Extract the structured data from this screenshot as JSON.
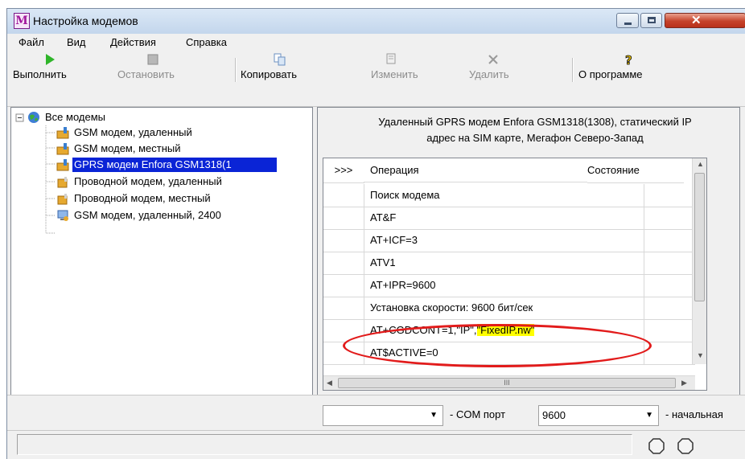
{
  "window": {
    "title": "Настройка модемов",
    "app_icon_letter": "M"
  },
  "menu": [
    "Файл",
    "Вид",
    "Действия",
    "Справка"
  ],
  "toolbar": {
    "run": "Выполнить",
    "stop": "Остановить",
    "copy": "Копировать",
    "edit": "Изменить",
    "delete": "Удалить",
    "about": "О программе"
  },
  "tree": {
    "root": "Все модемы",
    "items": [
      "GSM модем, удаленный",
      "GSM модем, местный",
      "GPRS модем Enfora GSM1318(1",
      "Проводной модем, удаленный",
      "Проводной модем, местный",
      "GSM модем, удаленный, 2400"
    ],
    "selected_index": 2
  },
  "detail": {
    "description_line1": "Удаленный GPRS модем Enfora GSM1318(1308), статический IP",
    "description_line2": "адрес на SIM карте, Мегафон Северо-Запад"
  },
  "grid": {
    "headers": {
      "arrow": ">>>",
      "operation": "Операция",
      "state": "Состояние"
    },
    "rows": [
      {
        "op": "Поиск модема"
      },
      {
        "op": "AT&F"
      },
      {
        "op": "AT+ICF=3"
      },
      {
        "op": "ATV1"
      },
      {
        "op": "AT+IPR=9600"
      },
      {
        "op": "Установка скорости: 9600 бит/сек"
      },
      {
        "op_prefix": "AT+CGDCONT=1,\"IP\",",
        "op_highlight": "\"FixedIP.nw\""
      },
      {
        "op": "AT$ACTIVE=0"
      }
    ],
    "hscroll_grip": "III"
  },
  "bottom": {
    "port_combo_value": "",
    "com_label": "- COM порт",
    "speed_value": "9600",
    "speed_label": "- начальная"
  },
  "colors": {
    "selection": "#0a24d6",
    "highlight": "#ffff00",
    "annotation": "#e21b1b"
  }
}
